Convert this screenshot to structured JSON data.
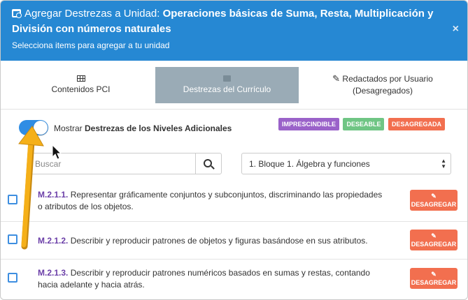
{
  "header": {
    "title_prefix": "Agregar Destrezas a Unidad: ",
    "title_bold": "Operaciones básicas de Suma, Resta, Multiplicación y División con números naturales",
    "subtitle": "Selecciona items para agregar a tu unidad",
    "close": "×"
  },
  "tabs": [
    {
      "label": "Contenidos PCI",
      "label2": ""
    },
    {
      "label": "Destrezas del Currículo",
      "label2": ""
    },
    {
      "label": "Redactados por Usuario",
      "label2": "(Desagregados)"
    }
  ],
  "toggle": {
    "label_prefix": "Mostrar ",
    "label_bold": "Destrezas de los Niveles Adicionales",
    "state": "on"
  },
  "badges": [
    {
      "label": "IMPRESCINDIBLE",
      "color": "#9a62c9"
    },
    {
      "label": "DESEABLE",
      "color": "#6fc584"
    },
    {
      "label": "DESAGREGADA",
      "color": "#f26f4f"
    }
  ],
  "search": {
    "placeholder": "Buscar",
    "value": ""
  },
  "filter": {
    "selected": "1. Bloque 1. Álgebra y funciones"
  },
  "items": [
    {
      "code": "M.2.1.1.",
      "text": " Representar gráficamente conjuntos y subconjuntos, discriminando las propiedades o atributos de los objetos.",
      "button": "DESAGREGAR"
    },
    {
      "code": "M.2.1.2.",
      "text": " Describir y reproducir patrones de objetos y figuras basándose en sus atributos.",
      "button": "DESAGREGAR"
    },
    {
      "code": "M.2.1.3.",
      "text": " Describir y reproducir patrones numéricos basados en sumas y restas, contando hacia adelante y hacia atrás.",
      "button": "DESAGREGAR"
    }
  ],
  "colors": {
    "header_bg": "#2688d3",
    "active_tab_bg": "#9aabb6",
    "toggle_on": "#2f8de4",
    "code_color": "#6b3fa8",
    "button_bg": "#f26f4f",
    "annotation_arrow": "#f5b019"
  }
}
